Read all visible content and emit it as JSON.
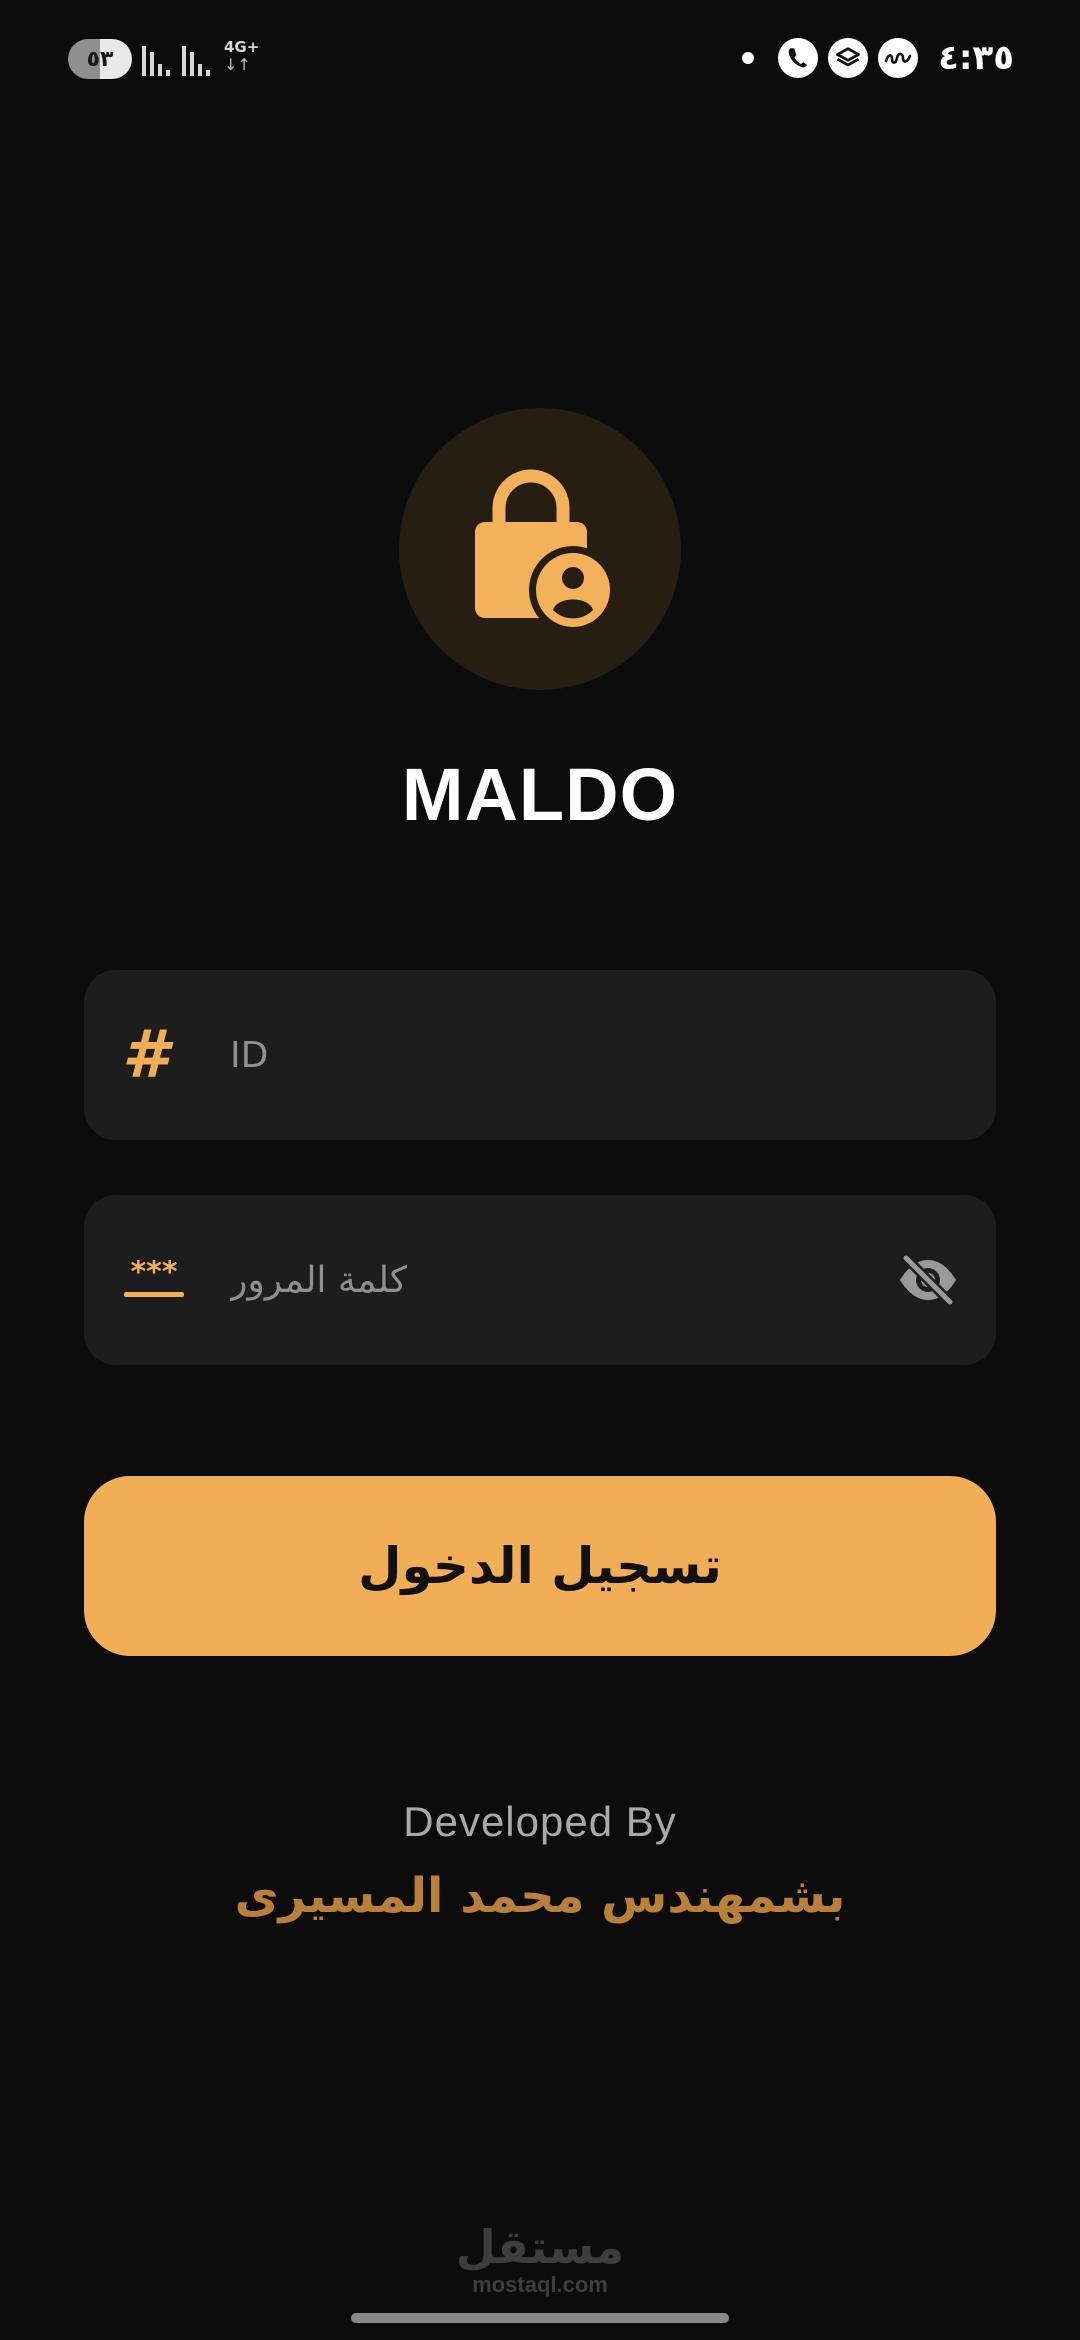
{
  "status_bar": {
    "battery": "٥٣",
    "network_type": "4G+",
    "network_arrows": "↓↑",
    "time": "٤:٣٥",
    "icons": [
      "dot-icon",
      "viber-icon",
      "stack-icon",
      "sim-carrier-icon"
    ]
  },
  "app": {
    "title": "MALDO",
    "logo_icon": "lock-person-icon",
    "accent_color": "#f1ae57"
  },
  "form": {
    "id_field": {
      "icon": "hash-icon",
      "placeholder": "ID",
      "value": ""
    },
    "password_field": {
      "icon": "password-stars-icon",
      "icon_text": "***",
      "placeholder": "كلمة المرور",
      "value": "",
      "toggle_icon": "eye-off-icon"
    },
    "login_label": "تسجيل الدخول"
  },
  "footer": {
    "developed_by": "Developed By",
    "developer_name": "بشمهندس محمد المسيرى"
  },
  "watermark": {
    "arabic": "مستقل",
    "latin": "mostaql.com"
  }
}
